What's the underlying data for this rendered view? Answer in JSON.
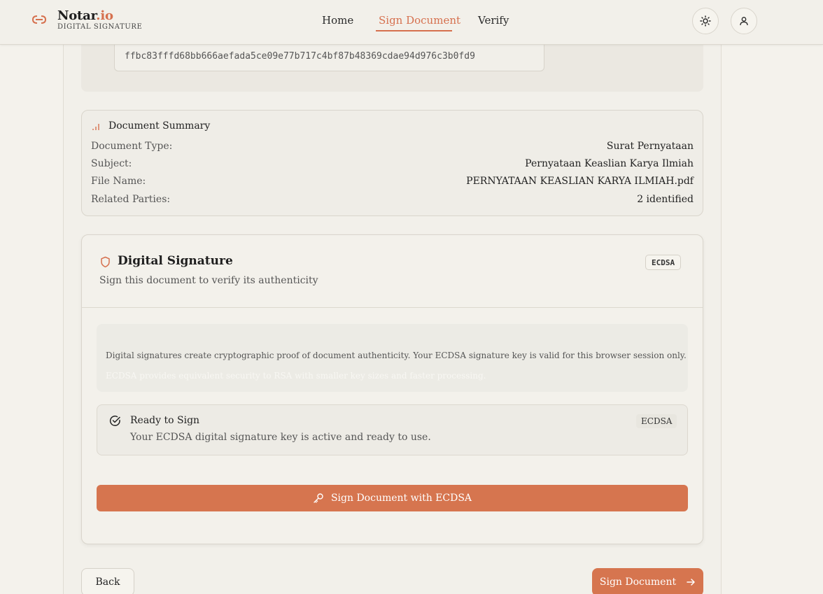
{
  "header": {
    "brand_name": "Notar",
    "brand_suffix": ".io",
    "brand_sub": "DIGITAL SIGNATURE",
    "nav": [
      {
        "label": "Home"
      },
      {
        "label": "Sign Document"
      },
      {
        "label": "Verify"
      }
    ],
    "active_nav": "Sign Document"
  },
  "hash": {
    "value": "ffbc83fffd68bb666aefada5ce09e77b717c4bf87b48369cdae94d976c3b0fd9"
  },
  "summary": {
    "title": "Document Summary",
    "rows": [
      {
        "label": "Document Type:",
        "value": "Surat Pernyataan"
      },
      {
        "label": "Subject:",
        "value": "Pernyataan Keaslian Karya Ilmiah"
      },
      {
        "label": "File Name:",
        "value": "PERNYATAAN KEASLIAN KARYA ILMIAH.pdf"
      },
      {
        "label": "Related Parties:",
        "value": "2 identified"
      }
    ]
  },
  "signature": {
    "title": "Digital Signature",
    "subtitle": "Sign this document to verify its authenticity",
    "algorithm_badge": "ECDSA",
    "info_line1": "Digital signatures create cryptographic proof of document authenticity. Your ECDSA signature key is valid for this browser session only.",
    "info_line2": "ECDSA provides equivalent security to RSA with smaller key sizes and faster processing.",
    "ready_title": "Ready to Sign",
    "ready_sub": "Your ECDSA digital signature key is active and ready to use.",
    "ready_badge": "ECDSA",
    "sign_button": "Sign Document with ECDSA"
  },
  "footer": {
    "back_label": "Back",
    "sign_label": "Sign Document"
  },
  "colors": {
    "accent": "#d6754f",
    "background": "#f4f2ec"
  },
  "icons": {
    "logo": "notar-logo-icon",
    "theme": "sun-icon",
    "user": "user-icon",
    "summary": "bar-chart-icon",
    "signature": "shield-icon",
    "ready": "check-circle-icon",
    "sign": "key-icon",
    "next": "arrow-right-icon"
  }
}
